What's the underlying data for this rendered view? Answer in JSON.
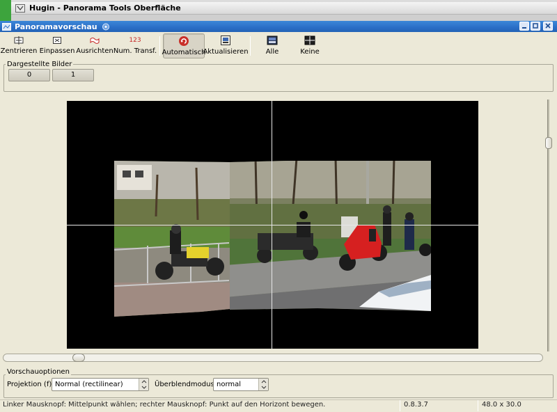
{
  "parent_window": {
    "title": "Hugin - Panorama Tools Oberfläche"
  },
  "window": {
    "title": "Panoramavorschau"
  },
  "toolbar": {
    "buttons": [
      {
        "label": "Zentrieren",
        "icon": "center-icon"
      },
      {
        "label": "Einpassen",
        "icon": "fit-icon"
      },
      {
        "label": "Ausrichten",
        "icon": "straighten-icon"
      },
      {
        "label": "Num. Transf.",
        "icon": "num-transform-icon",
        "icon_text": "123"
      },
      {
        "label": "Automatisch",
        "icon": "auto-update-icon",
        "pressed": true
      },
      {
        "label": "Aktualisieren",
        "icon": "update-icon"
      },
      {
        "label": "Alle",
        "icon": "show-all-icon"
      },
      {
        "label": "Keine",
        "icon": "show-none-icon"
      }
    ]
  },
  "displayed_images": {
    "label": "Dargestellte Bilder",
    "images": [
      "0",
      "1"
    ]
  },
  "preview": {
    "image_alt": "Panoramavorschau – Motorräder auf der Straße"
  },
  "options": {
    "label": "Vorschauoptionen",
    "projection_label": "Projektion (f):",
    "projection_value": "Normal (rectilinear)",
    "blend_label": "Überblendmodus:",
    "blend_value": "normal"
  },
  "statusbar": {
    "message": "Linker Mausknopf: Mittelpunkt wählen; rechter Mausknopf: Punkt auf den Horizont bewegen.",
    "version": "0.8.3.7",
    "fov": "48.0 x 30.0"
  },
  "colors": {
    "titlebar": "#2a6ec6",
    "window_bg": "#ece9d8",
    "canvas_bg": "#000000"
  }
}
